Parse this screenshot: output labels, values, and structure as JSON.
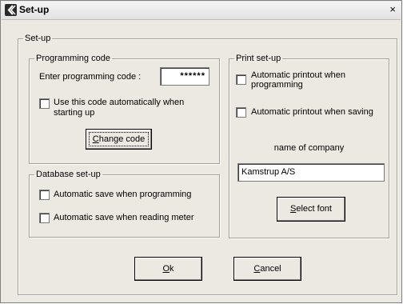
{
  "window": {
    "title": "Set-up",
    "close": "×"
  },
  "setup_group": {
    "legend": "Set-up"
  },
  "programming": {
    "legend": "Programming code",
    "enter_label": "Enter programming code :",
    "code_value": "******",
    "auto_use_label_1": "Use this code automatically when",
    "auto_use_label_2": "starting up",
    "change_code_pre": "",
    "change_code_mnemonic": "C",
    "change_code_post": "hange code"
  },
  "database": {
    "legend": "Database set-up",
    "auto_save_programming": "Automatic save when programming",
    "auto_save_reading": "Automatic save when reading meter"
  },
  "print": {
    "legend": "Print set-up",
    "auto_print_programming_1": "Automatic printout when",
    "auto_print_programming_2": "programming",
    "auto_print_saving": "Automatic printout when saving",
    "company_label": "name of company",
    "company_value": "Kamstrup A/S",
    "select_font_mnemonic": "S",
    "select_font_post": "elect font"
  },
  "buttons": {
    "ok_mnemonic": "O",
    "ok_post": "k",
    "cancel_mnemonic": "C",
    "cancel_post": "ancel"
  }
}
